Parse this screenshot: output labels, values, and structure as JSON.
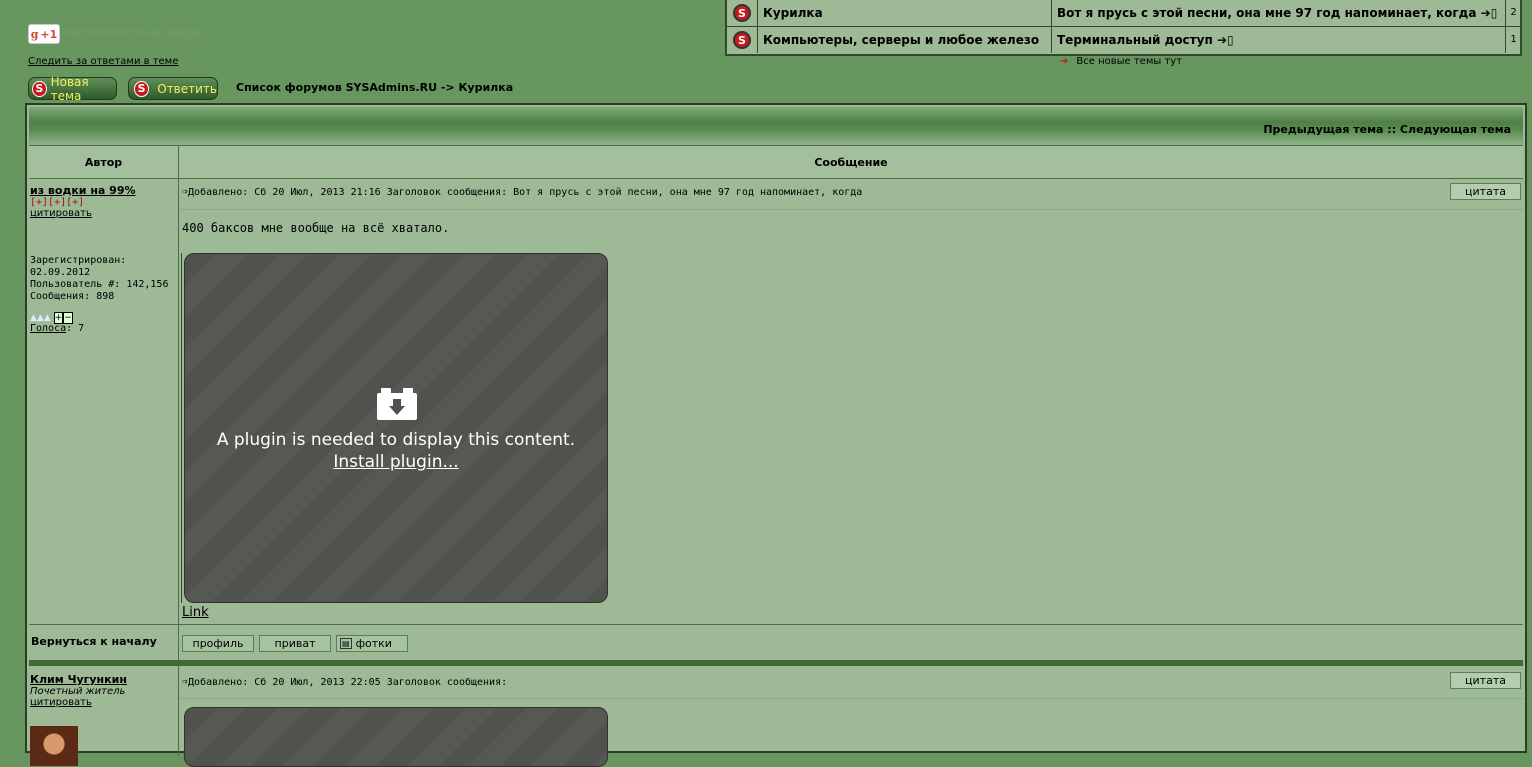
{
  "gplus": {
    "label": "+1",
    "g": "g",
    "recommend": "Recommend this on Google"
  },
  "watch_link": "Следить за ответами в теме",
  "buttons": {
    "new_topic": "Новая тема",
    "reply": "Ответить",
    "s": "S"
  },
  "breadcrumb": "Список форумов SYSAdmins.RU -> Курилка",
  "new_topics": {
    "rows": [
      {
        "forum": "Курилка",
        "topic": "Вот я прусь с этой песни, она мне 97 год напоминает, когда",
        "count": "2"
      },
      {
        "forum": "Компьютеры, серверы и любое железо",
        "topic": "Терминальный доступ",
        "count": "1"
      }
    ],
    "all_new": "Все новые темы тут"
  },
  "nav": {
    "prev_next": "Предыдущая тема :: Следующая тема"
  },
  "columns": {
    "author": "Автор",
    "message": "Сообщение"
  },
  "posts": [
    {
      "author": "из водки на 99%",
      "marks": "[+][+][+]",
      "quote_link": "цитировать",
      "registered": "Зарегистрирован: 02.09.2012",
      "user_no": "Пользователь #: 142,156",
      "messages": "Сообщения: 898",
      "votes_label": "Голоса",
      "votes_value": ": 7",
      "meta": "Добавлено: Сб 20 Июл, 2013 21:16   Заголовок сообщения: Вот я прусь с этой песни, она мне 97 год напоминает, когда",
      "quote_btn": "цитата",
      "text": "400 баксов мне вообще на всё хватало.",
      "plugin_msg": "A plugin is needed to display this content.",
      "plugin_link": "Install plugin...",
      "link": "Link"
    },
    {
      "author": "Клим Чугункин",
      "title": "Почетный житель",
      "quote_link": "цитировать",
      "meta": "Добавлено: Сб 20 Июл, 2013 22:05   Заголовок сообщения:",
      "quote_btn": "цитата"
    }
  ],
  "back_to_top": "Вернуться к началу",
  "profile_buttons": {
    "profile": "профиль",
    "private": "приват",
    "photos": "фотки"
  }
}
